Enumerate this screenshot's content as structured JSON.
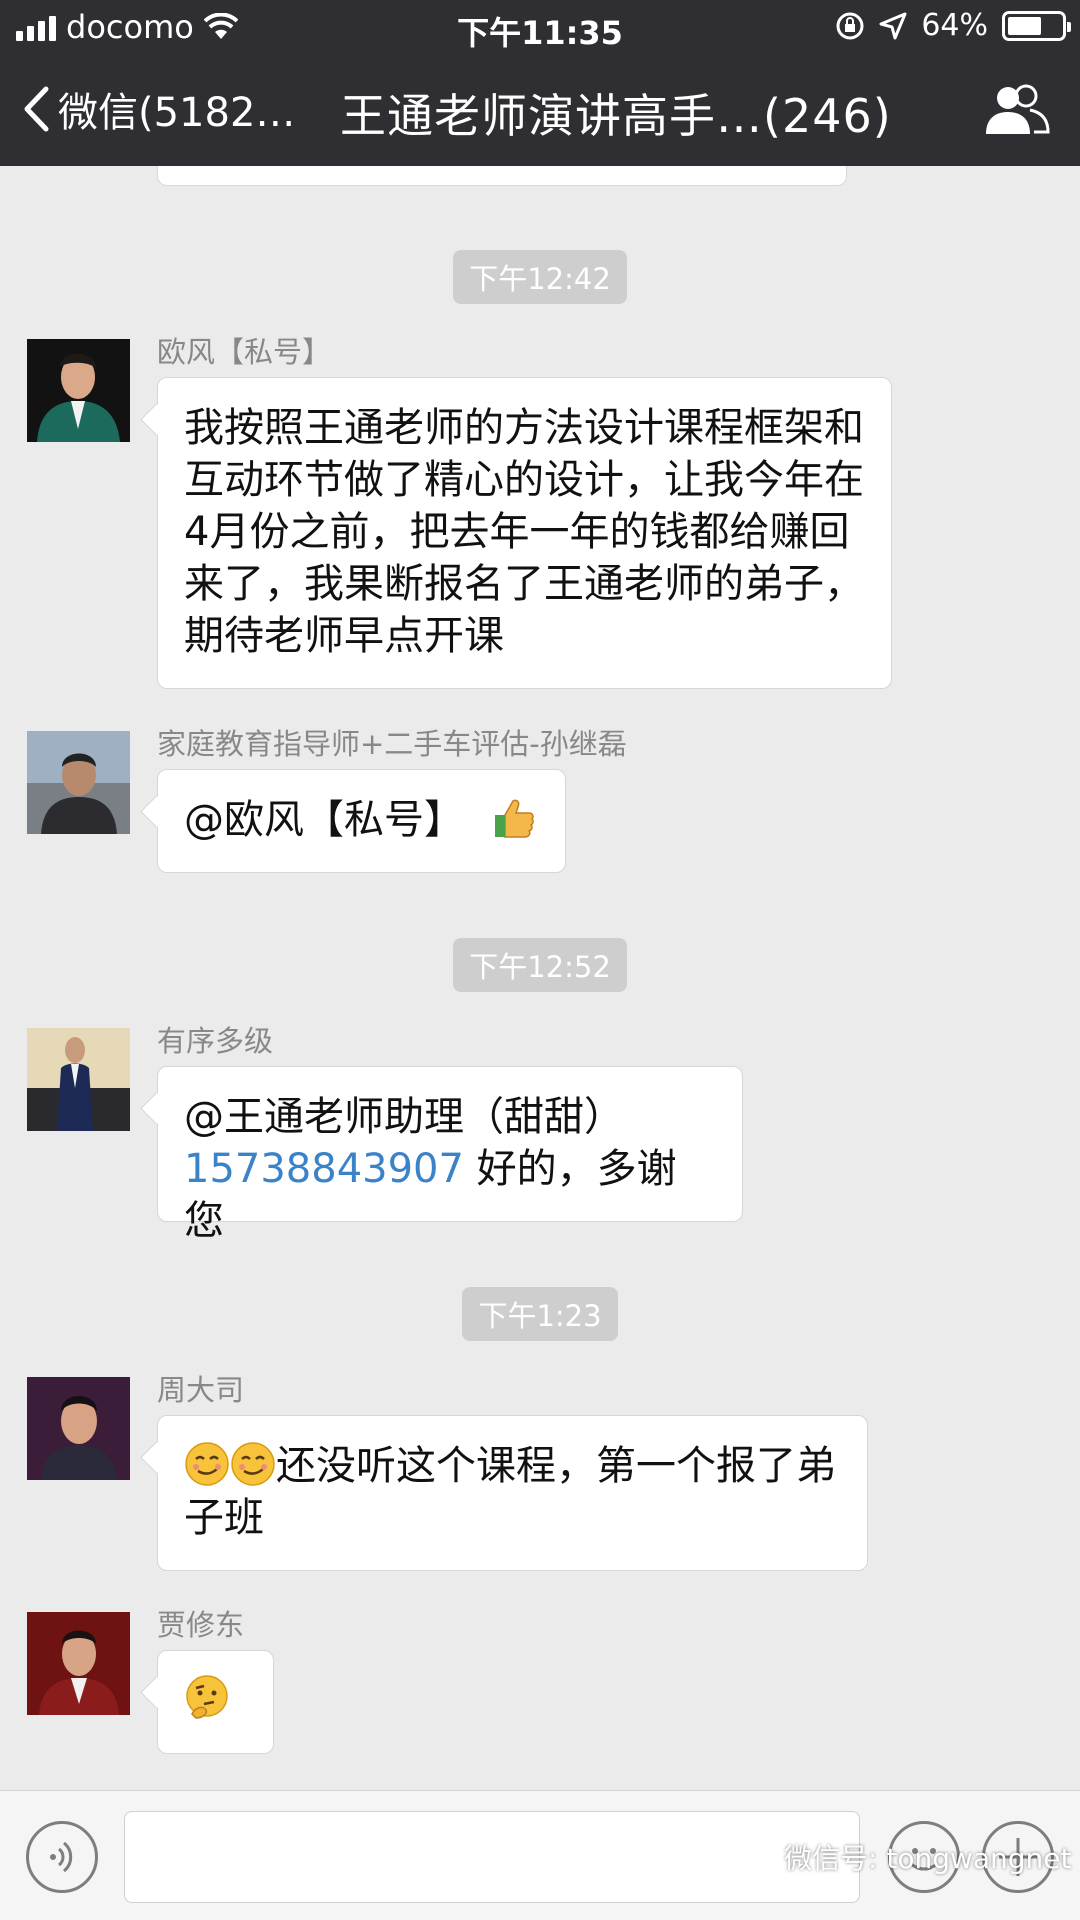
{
  "status_bar": {
    "carrier": "docomo",
    "time": "下午11:35",
    "battery": "64%",
    "battery_level": 0.64
  },
  "nav": {
    "back_label": "微信(5182…",
    "title": "王通老师演讲高手…(246)"
  },
  "chat": {
    "timestamps": [
      "下午12:42",
      "下午12:52",
      "下午1:23"
    ],
    "messages": [
      {
        "sender": "欧风【私号】",
        "text": "我按照王通老师的方法设计课程框架和互动环节做了精心的设计，让我今年在4月份之前，把去年一年的钱都给赚回来了，我果断报名了王通老师的弟子，期待老师早点开课"
      },
      {
        "sender": "家庭教育指导师+二手车评估-孙继磊",
        "text": "@欧风【私号】",
        "emoji": "thumbs-up"
      },
      {
        "sender": "有序多级",
        "text": "@王通老师助理（甜甜）",
        "phone": "15738843907",
        "text_after": "好的，多谢您"
      },
      {
        "sender": "周大司",
        "emoji": "smirk",
        "text": "还没听这个课程，第一个报了弟子班"
      },
      {
        "sender": "贾修东",
        "emoji": "thinking"
      }
    ]
  },
  "input_bar": {
    "watermark": "微信号: tongwangnet"
  },
  "colors": {
    "bar": "#2e2e33",
    "chat_bg": "#ebebeb",
    "link": "#3b83c8",
    "timestamp_bg": "#cecece"
  }
}
